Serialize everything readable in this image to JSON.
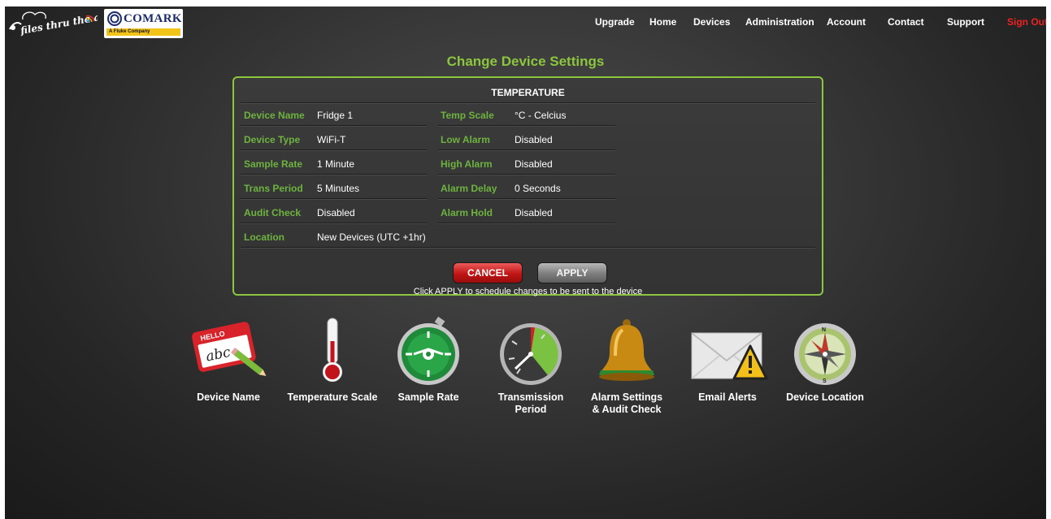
{
  "brand": {
    "logo_text": "files thru the air",
    "partner_name": "COMARK",
    "partner_sub": "A Fluke Company"
  },
  "nav": {
    "items": [
      "Upgrade",
      "Home",
      "Devices",
      "Administration",
      "Account",
      "Contact",
      "Support"
    ],
    "signout": "Sign Out",
    "signout_color": "#ee2222"
  },
  "page": {
    "title": "Change Device Settings",
    "section_title": "TEMPERATURE",
    "accent_color": "#8cc63f"
  },
  "settings": {
    "left": [
      {
        "label": "Device Name",
        "value": "Fridge 1"
      },
      {
        "label": "Device Type",
        "value": "WiFi-T"
      },
      {
        "label": "Sample Rate",
        "value": "1 Minute"
      },
      {
        "label": "Trans Period",
        "value": "5 Minutes"
      },
      {
        "label": "Audit Check",
        "value": "Disabled"
      }
    ],
    "right": [
      {
        "label": "Temp Scale",
        "value": "°C - Celcius"
      },
      {
        "label": "Low Alarm",
        "value": "Disabled"
      },
      {
        "label": "High Alarm",
        "value": "Disabled"
      },
      {
        "label": "Alarm Delay",
        "value": "0 Seconds"
      },
      {
        "label": "Alarm Hold",
        "value": "Disabled"
      }
    ],
    "location": {
      "label": "Location",
      "value": "New Devices  (UTC +1hr)"
    }
  },
  "actions": {
    "cancel": "CANCEL",
    "apply": "APPLY",
    "note": "Click APPLY to schedule changes to be sent to the device"
  },
  "tiles": [
    {
      "icon": "name-tag-icon",
      "label": "Device Name",
      "tag_text": "HELLO",
      "tag_script": "abc"
    },
    {
      "icon": "thermometer-icon",
      "label": "Temperature Scale"
    },
    {
      "icon": "stopwatch-icon",
      "label": "Sample Rate"
    },
    {
      "icon": "dial-clock-icon",
      "label": "Transmission Period"
    },
    {
      "icon": "bell-icon",
      "label": "Alarm Settings & Audit Check"
    },
    {
      "icon": "envelope-warning-icon",
      "label": "Email Alerts"
    },
    {
      "icon": "compass-icon",
      "label": "Device Location"
    }
  ]
}
